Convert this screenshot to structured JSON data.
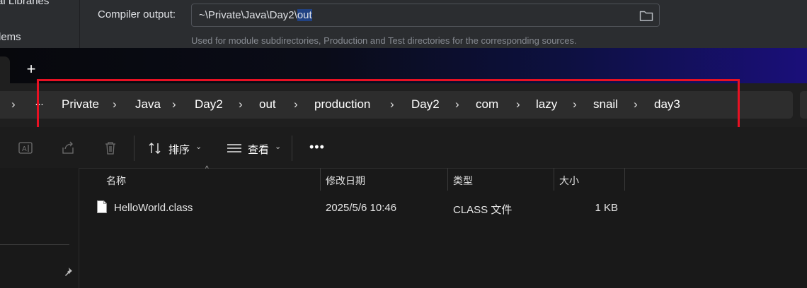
{
  "ide": {
    "sidebar_items": [
      "al Libraries",
      "lems"
    ],
    "compiler_output_label": "Compiler output:",
    "compiler_output_prefix": "~\\Private\\Java\\Day2\\",
    "compiler_output_selected": "out",
    "compiler_output_hint": "Used for module subdirectories, Production and Test directories for the corresponding sources."
  },
  "explorer": {
    "new_tab_label": "+",
    "breadcrumb": {
      "back_chevron": "›",
      "overflow": "···",
      "items": [
        "Private",
        "Java",
        "Day2",
        "out",
        "production",
        "Day2",
        "com",
        "lazy",
        "snail",
        "day3"
      ]
    },
    "toolbar": {
      "sort_label": "排序",
      "view_label": "查看",
      "more_label": "•••"
    },
    "columns": [
      "名称",
      "修改日期",
      "类型",
      "大小"
    ],
    "files": [
      {
        "name": "HelloWorld.class",
        "modified": "2025/5/6 10:46",
        "type": "CLASS 文件",
        "size": "1 KB"
      }
    ]
  },
  "colors": {
    "highlight_box": "#e81123",
    "selection": "#214283"
  }
}
